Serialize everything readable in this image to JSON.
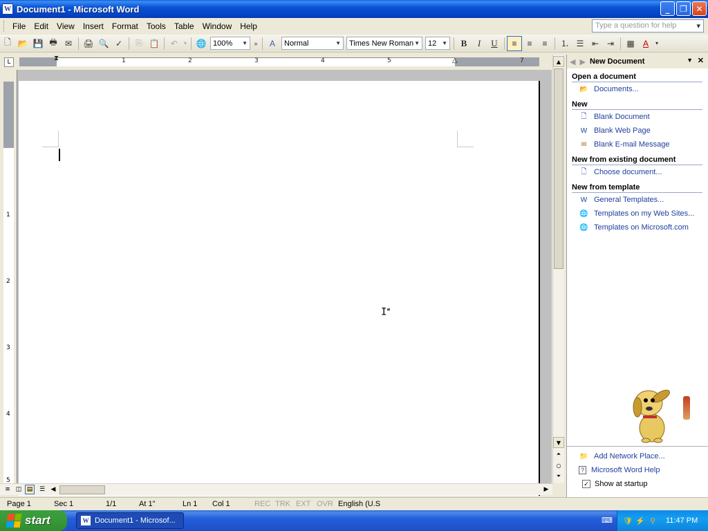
{
  "window": {
    "title": "Document1 - Microsoft Word",
    "app_icon": "W"
  },
  "menubar": {
    "items": [
      "File",
      "Edit",
      "View",
      "Insert",
      "Format",
      "Tools",
      "Table",
      "Window",
      "Help"
    ],
    "help_placeholder": "Type a question for help"
  },
  "toolbar": {
    "zoom": "100%",
    "style": "Normal",
    "font": "Times New Roman",
    "size": "12",
    "bold": "B",
    "italic": "I",
    "underline": "U"
  },
  "ruler": {
    "numbers": [
      "1",
      "2",
      "3",
      "4",
      "5",
      "7"
    ]
  },
  "vruler": {
    "numbers": [
      "1",
      "2",
      "3",
      "4",
      "5"
    ]
  },
  "taskpane": {
    "title": "New Document",
    "sections": {
      "open": "Open a document",
      "new": "New",
      "existing": "New from existing document",
      "template": "New from template"
    },
    "links": {
      "documents": "Documents...",
      "blank_document": "Blank Document",
      "blank_web": "Blank Web Page",
      "blank_email": "Blank E-mail Message",
      "choose": "Choose document...",
      "general_templates": "General Templates...",
      "web_templates": "Templates on my Web Sites...",
      "ms_templates": "Templates on Microsoft.com",
      "network_place": "Add Network Place...",
      "word_help": "Microsoft Word Help",
      "show_startup": "Show at startup"
    },
    "show_at_startup_checked": true
  },
  "statusbar": {
    "page": "Page  1",
    "sec": "Sec  1",
    "pages": "1/1",
    "at": "At  1\"",
    "ln": "Ln  1",
    "col": "Col  1",
    "rec": "REC",
    "trk": "TRK",
    "ext": "EXT",
    "ovr": "OVR",
    "language": "English (U.S"
  },
  "taskbar": {
    "start": "start",
    "task": "Document1 - Microsof...",
    "clock": "11:47 PM"
  }
}
